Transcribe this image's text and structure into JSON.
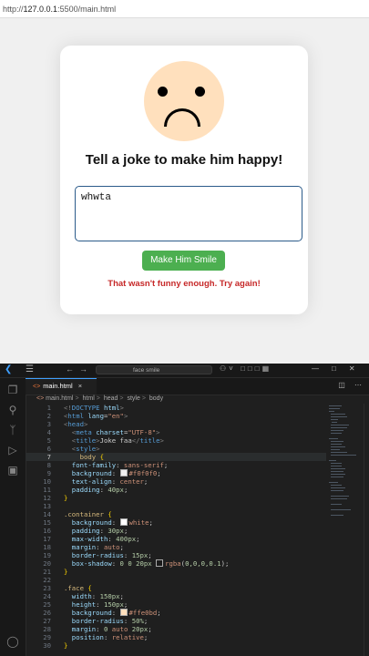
{
  "browser": {
    "url_prefix": "http://",
    "url_host": "127.0.0.1",
    "url_rest": ":5500/main.html"
  },
  "page": {
    "title": "Tell a joke to make him happy!",
    "joke_value": "whwta",
    "button_label": "Make Him Smile",
    "feedback": "That wasn't funny enough. Try again!",
    "face_color": "#ffe0bd",
    "button_color": "#4caf50",
    "feedback_color": "#c62828"
  },
  "editor": {
    "search_text": "face smile",
    "tab_label": "main.html",
    "breadcrumb": [
      "main.html",
      "html",
      "head",
      "style",
      "body"
    ],
    "current_line": 7
  }
}
